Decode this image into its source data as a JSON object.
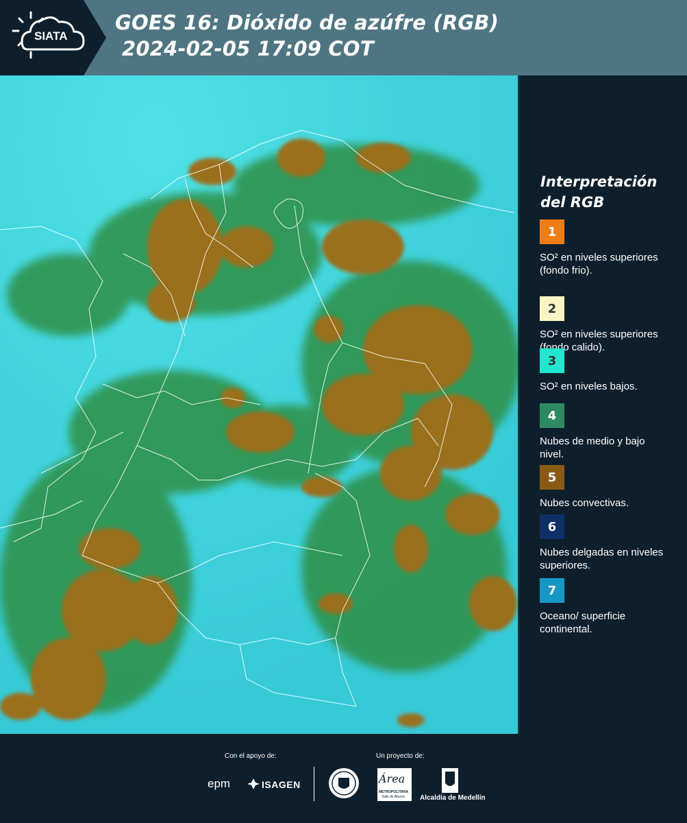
{
  "header": {
    "logo_text": "SIATA",
    "title_line1": "GOES 16: Dióxido de azúfre (RGB)",
    "title_line2": "2024-02-05 17:09 COT"
  },
  "legend": {
    "title": "Interpretación del RGB",
    "items": [
      {
        "number": "1",
        "color": "#f07d14",
        "text": "SO² en niveles superiores (fondo frio)."
      },
      {
        "number": "2",
        "color": "#fcf5c3",
        "text": "SO² en niveles superiores (fondo calido)."
      },
      {
        "number": "3",
        "color": "#22e6cf",
        "text": "SO² en niveles bajos."
      },
      {
        "number": "4",
        "color": "#2e8a62",
        "text": "Nubes de medio y bajo nivel."
      },
      {
        "number": "5",
        "color": "#8a5a14",
        "text": "Nubes convectivas."
      },
      {
        "number": "6",
        "color": "#0f2f68",
        "text": "Nubes delgadas en niveles superiores."
      },
      {
        "number": "7",
        "color": "#1797c4",
        "text": "Oceano/ superficie continental."
      }
    ]
  },
  "footer": {
    "support_label": "Con el apoyo de:",
    "project_label": "Un proyecto de:",
    "sponsors": [
      "epm",
      "ISAGEN"
    ],
    "partners": [
      "Área Metropolitana Valle de Aburrá",
      "Alcaldía de Medellín"
    ],
    "partner_caption_area": "METROPOLITANA",
    "partner_caption_area_sub": "Valle de Aburrá",
    "partner_caption_alcaldia": "Alcaldía de Medellín",
    "area_logo_text": "Área"
  },
  "colors": {
    "header_bg": "#4f7582",
    "panel_bg": "#0d1f2c",
    "map_background": "#3fd3df",
    "cloud_convective": "#9a6f1e",
    "cloud_low": "#2e8a3e"
  }
}
